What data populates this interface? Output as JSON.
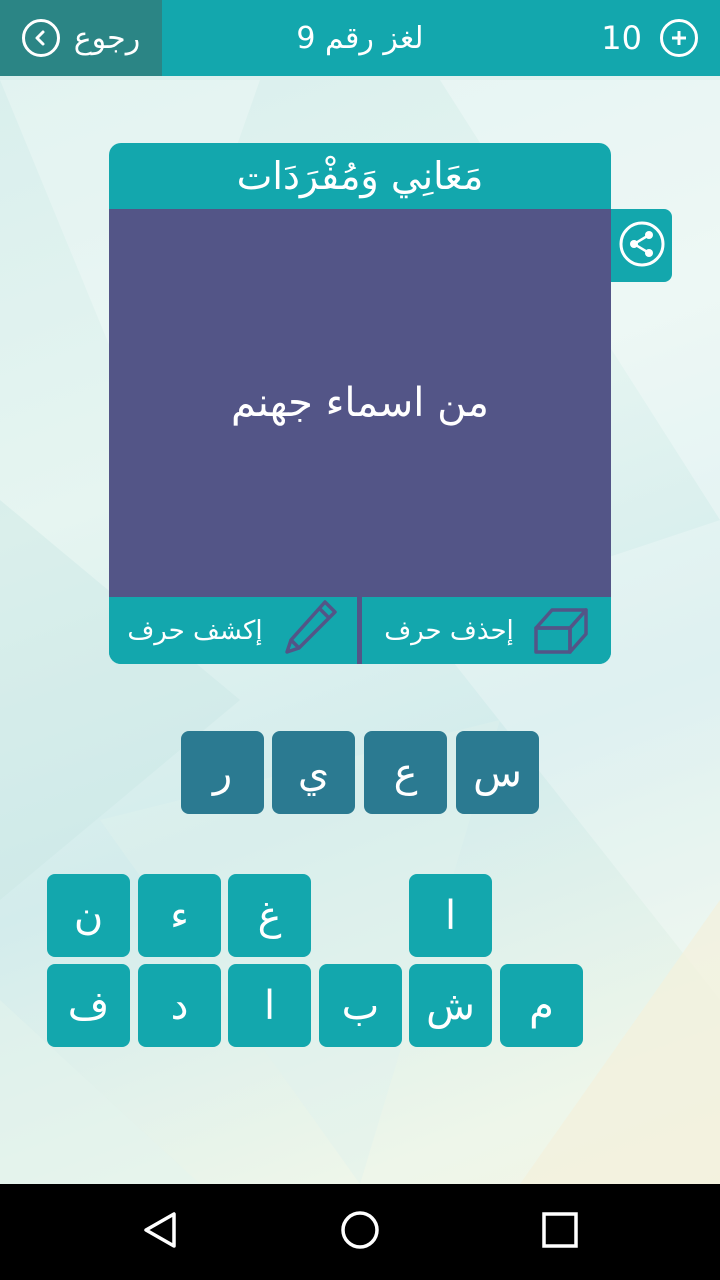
{
  "topbar": {
    "back_label": "رجوع",
    "level_title": "لغز رقم 9",
    "coins": "10"
  },
  "card": {
    "category_title": "مَعَانِي وَمُفْرَدَات",
    "clue": "من اسماء جهنم",
    "reveal_label": "إكشف حرف",
    "delete_label": "إحذف حرف"
  },
  "answer": {
    "slots": [
      "س",
      "ع",
      "ي",
      "ر"
    ]
  },
  "letters": {
    "row1": [
      "ا",
      "غ",
      "ء",
      "ن"
    ],
    "row2": [
      "م",
      "ش",
      "ب",
      "ا",
      "د",
      "ف"
    ]
  },
  "colors": {
    "primary": "#13a7ad",
    "dark_teal": "#2b8585",
    "clue_bg": "#535587",
    "answer_slot": "#2b7a91"
  },
  "icons": {
    "back": "chevron-left-icon",
    "coins": "plus-icon",
    "share": "share-icon",
    "reveal": "pencil-icon",
    "delete": "eraser-icon"
  }
}
